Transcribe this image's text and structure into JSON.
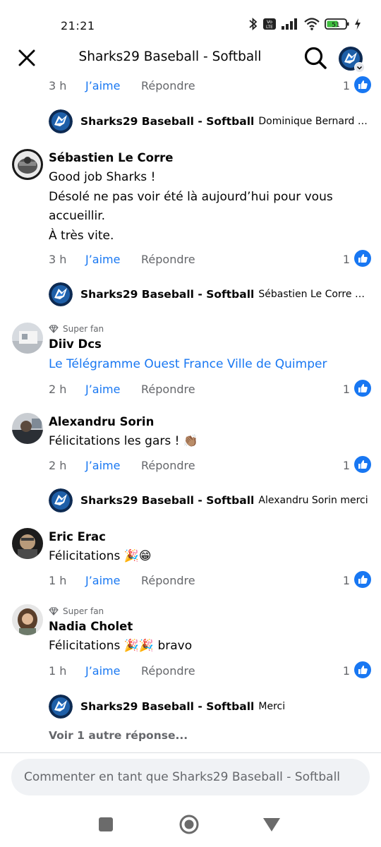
{
  "status_bar": {
    "time": "21:21",
    "battery": "51",
    "icons": [
      "bluetooth-icon",
      "volte-icon",
      "signal-icon",
      "wifi-icon",
      "battery-icon",
      "charging-icon"
    ]
  },
  "header": {
    "title": "Sharks29 Baseball - Softball"
  },
  "labels": {
    "like": "J'aime",
    "reply": "Répondre"
  },
  "colors": {
    "accent": "#1877f2",
    "secondary_text": "#65676b"
  },
  "top_actions": {
    "time": "3 h",
    "like": "J’aime",
    "reply": "Répondre",
    "count": "1"
  },
  "reply_1": {
    "page": "Sharks29 Baseball - Softball",
    "text": "Dominique Bernard merci…"
  },
  "comments": [
    {
      "name": "Sébastien Le Corre",
      "lines": [
        "Good job Sharks !",
        "Désolé ne pas voir été là aujourd’hui pour vous",
        "accueillir.",
        "À très vite."
      ],
      "time": "3 h",
      "count": "1"
    },
    {
      "badge": "Super fan",
      "name": "Diiv Dcs",
      "link": "Le Télégramme Ouest France Ville de Quimper",
      "time": "2 h",
      "count": "1"
    },
    {
      "name": "Alexandru Sorin",
      "text": "Félicitations les gars ! 👏🏽",
      "time": "2 h",
      "count": "1"
    },
    {
      "name": "Eric Erac",
      "text": "Félicitations 🎉😁",
      "time": "1 h",
      "count": "1"
    },
    {
      "badge": "Super fan",
      "name": "Nadia Cholet",
      "text": "Félicitations 🎉🎉 bravo",
      "time": "1 h",
      "count": "1"
    }
  ],
  "reply_2": {
    "page": "Sharks29 Baseball - Softball",
    "text": "Sébastien Le Corre mer…"
  },
  "reply_3": {
    "page": "Sharks29 Baseball - Softball",
    "text": "Alexandru Sorin merci"
  },
  "reply_4": {
    "page": "Sharks29 Baseball - Softball",
    "text": "Merci"
  },
  "view_more": "Voir 1 autre réponse...",
  "composer": {
    "placeholder": "Commenter en tant que Sharks29 Baseball - Softball"
  },
  "navbar": [
    "square-recents-icon",
    "circle-home-icon",
    "triangle-back-icon"
  ]
}
